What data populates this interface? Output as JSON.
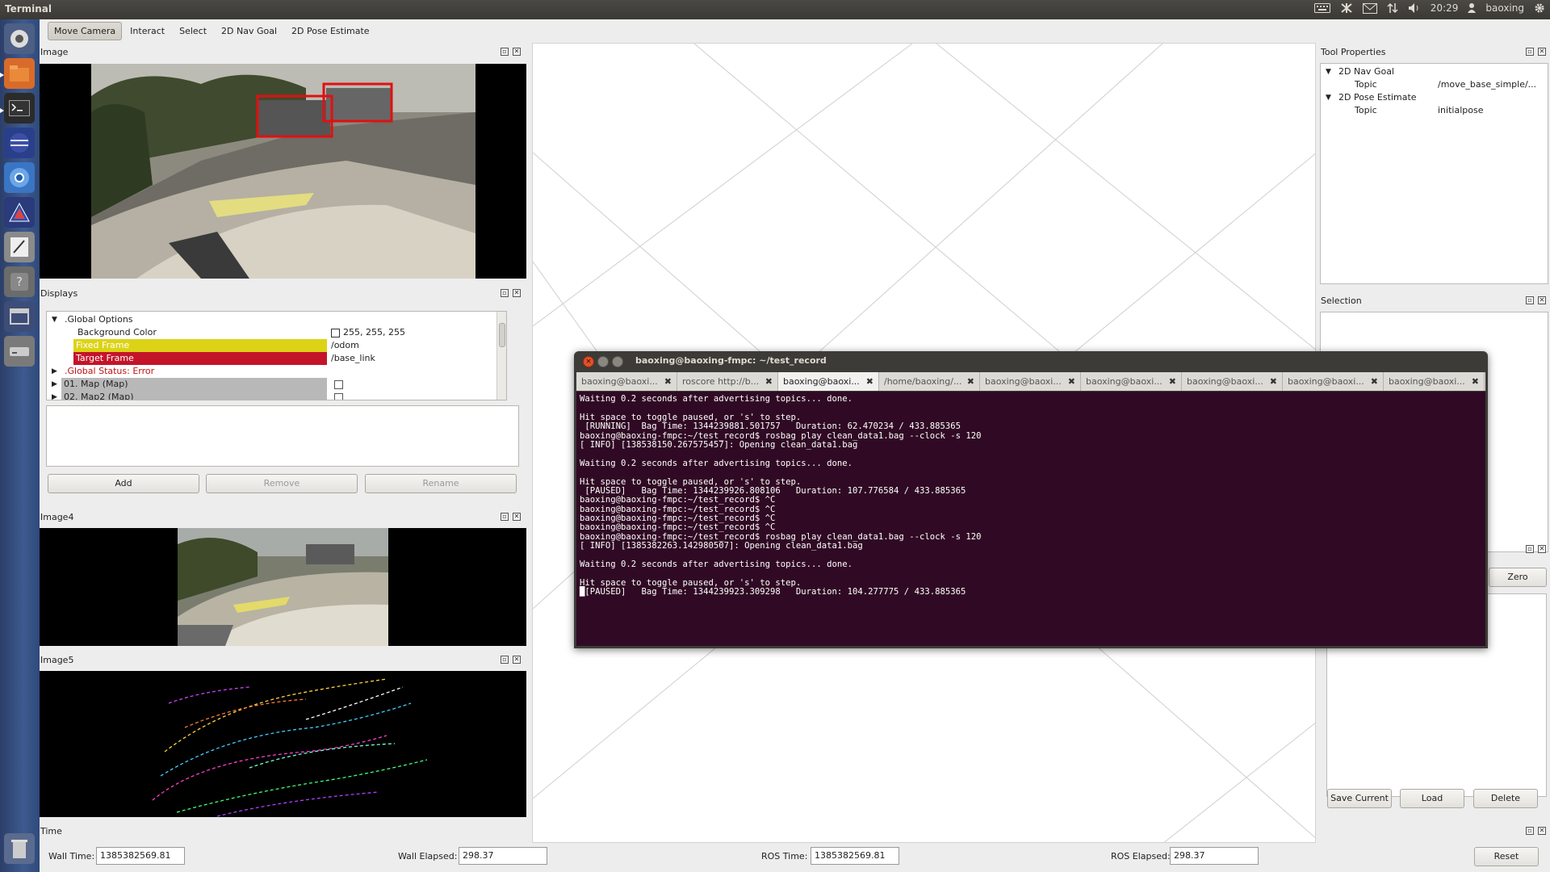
{
  "topbar": {
    "title": "Terminal",
    "time": "20:29",
    "user": "baoxing"
  },
  "toolbar": {
    "tools": [
      "Move Camera",
      "Interact",
      "Select",
      "2D Nav Goal",
      "2D Pose Estimate"
    ]
  },
  "image_panel": {
    "title": "Image"
  },
  "displays": {
    "title": "Displays",
    "global_options": ".Global Options",
    "background_color_label": "Background Color",
    "background_color_value": "255, 255, 255",
    "fixed_frame_label": "Fixed Frame",
    "fixed_frame_value": "/odom",
    "target_frame_label": "Target Frame",
    "target_frame_value": "/base_link",
    "global_status": ".Global Status: Error",
    "map1": "01. Map (Map)",
    "map2": "02. Map2 (Map)",
    "add": "Add",
    "remove": "Remove",
    "rename": "Rename"
  },
  "image4": {
    "title": "Image4"
  },
  "image5": {
    "title": "Image5"
  },
  "tool_properties": {
    "title": "Tool Properties",
    "nav_goal": "2D Nav Goal",
    "nav_goal_topic_label": "Topic",
    "nav_goal_topic": "/move_base_simple/...",
    "pose_estimate": "2D Pose Estimate",
    "pose_topic_label": "Topic",
    "pose_topic": "initialpose"
  },
  "selection": {
    "title": "Selection"
  },
  "views": {
    "zero": "Zero",
    "save_current": "Save Current",
    "load": "Load",
    "delete": "Delete"
  },
  "time": {
    "title": "Time",
    "wall_time_label": "Wall Time:",
    "wall_time": "1385382569.81",
    "wall_elapsed_label": "Wall Elapsed:",
    "wall_elapsed": "298.37",
    "ros_time_label": "ROS Time:",
    "ros_time": "1385382569.81",
    "ros_elapsed_label": "ROS Elapsed:",
    "ros_elapsed": "298.37",
    "reset": "Reset"
  },
  "terminal": {
    "title": "baoxing@baoxing-fmpc: ~/test_record",
    "tabs": [
      "baoxing@baoxi...",
      "roscore http://b...",
      "baoxing@baoxi...",
      "/home/baoxing/...",
      "baoxing@baoxi...",
      "baoxing@baoxi...",
      "baoxing@baoxi...",
      "baoxing@baoxi...",
      "baoxing@baoxi..."
    ],
    "active_tab": 2,
    "lines": [
      "Waiting 0.2 seconds after advertising topics... done.",
      "",
      "Hit space to toggle paused, or 's' to step.",
      " [RUNNING]  Bag Time: 1344239881.501757   Duration: 62.470234 / 433.885365",
      "baoxing@baoxing-fmpc:~/test_record$ rosbag play clean_data1.bag --clock -s 120",
      "[ INFO] [138538150.267575457]: Opening clean_data1.bag",
      "",
      "Waiting 0.2 seconds after advertising topics... done.",
      "",
      "Hit space to toggle paused, or 's' to step.",
      " [PAUSED]   Bag Time: 1344239926.808106   Duration: 107.776584 / 433.885365",
      "baoxing@baoxing-fmpc:~/test_record$ ^C",
      "baoxing@baoxing-fmpc:~/test_record$ ^C",
      "baoxing@baoxing-fmpc:~/test_record$ ^C",
      "baoxing@baoxing-fmpc:~/test_record$ ^C",
      "baoxing@baoxing-fmpc:~/test_record$ rosbag play clean_data1.bag --clock -s 120",
      "[ INFO] [1385382263.142980507]: Opening clean_data1.bag",
      "",
      "Waiting 0.2 seconds after advertising topics... done.",
      "",
      "Hit space to toggle paused, or 's' to step.",
      "█[PAUSED]   Bag Time: 1344239923.309298   Duration: 104.277775 / 433.885365"
    ]
  },
  "colors": {
    "fixed_frame_bg": "#dcd317",
    "target_frame_bg": "#c4142a",
    "error_text": "#c01010",
    "terminal_bg": "#300a24"
  }
}
